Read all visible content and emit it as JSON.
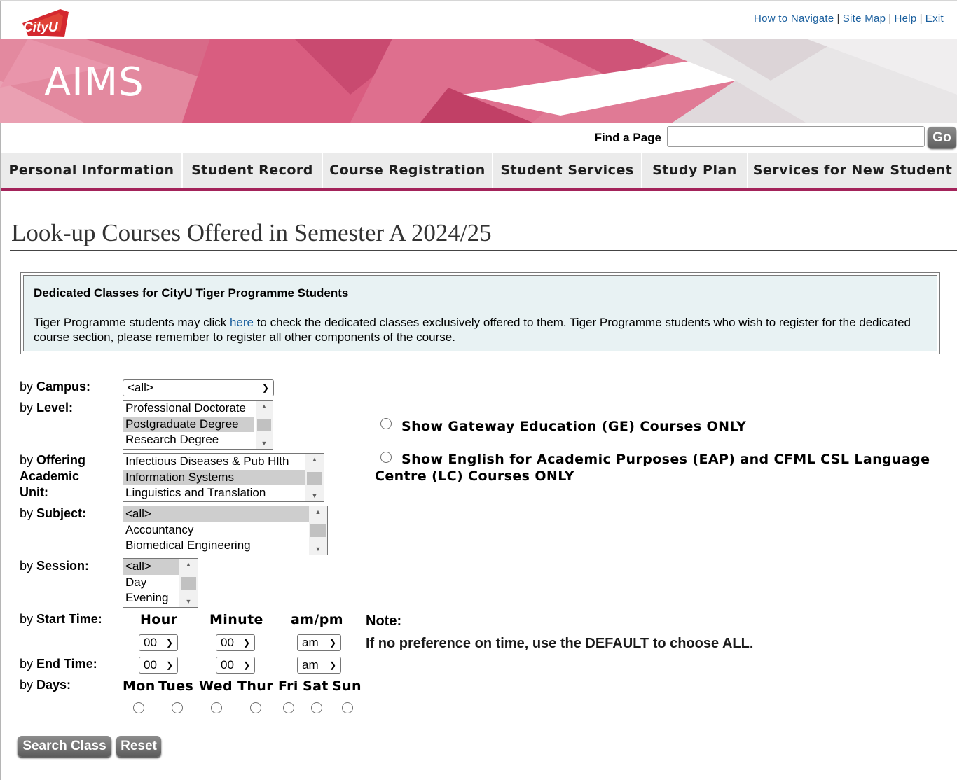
{
  "header": {
    "logo_text": "CityU",
    "links": [
      "How to Navigate",
      "Site Map",
      "Help",
      "Exit"
    ],
    "banner_title": "AIMS"
  },
  "find": {
    "label": "Find a Page",
    "value": "",
    "go_label": "Go"
  },
  "nav": [
    "Personal Information",
    "Student Record",
    "Course Registration",
    "Student Services",
    "Study Plan",
    "Services for New Student"
  ],
  "page_title": "Look-up Courses Offered in Semester A 2024/25",
  "notice": {
    "heading": "Dedicated Classes for CityU Tiger Programme Students",
    "text_1": "Tiger Programme students may click ",
    "link": "here",
    "text_2": " to check the dedicated classes exclusively offered to them. Tiger Programme students who wish to register for the dedicated course section, please remember to register ",
    "underlined": "all other components",
    "text_3": " of the course."
  },
  "filters": {
    "campus": {
      "prefix": "by ",
      "label": "Campus:",
      "value": "<all>"
    },
    "level": {
      "prefix": "by ",
      "label": "Level:",
      "options": [
        "Professional Doctorate",
        "Postgraduate Degree",
        "Research Degree"
      ],
      "selected": 1
    },
    "unit": {
      "prefix": "by ",
      "label_1": "Offering",
      "label_2": "Academic",
      "label_3": "Unit:",
      "options": [
        "Infectious Diseases & Pub Hlth",
        "Information Systems",
        "Linguistics and Translation"
      ],
      "selected": 1
    },
    "subject": {
      "prefix": "by ",
      "label": "Subject:",
      "options": [
        "<all>",
        "Accountancy",
        "Biomedical Engineering"
      ],
      "selected": 0
    },
    "session": {
      "prefix": "by ",
      "label": "Session:",
      "options": [
        "<all>",
        "Day",
        "Evening"
      ],
      "selected": 0
    },
    "start_time": {
      "prefix": "by ",
      "label": "Start Time:",
      "hour": "00",
      "minute": "00",
      "ampm": "am"
    },
    "end_time": {
      "prefix": "by ",
      "label": "End Time:",
      "hour": "00",
      "minute": "00",
      "ampm": "am"
    },
    "time_columns": {
      "hour": "Hour",
      "minute": "Minute",
      "ampm": "am/pm"
    },
    "days": {
      "prefix": "by ",
      "label": "Days:",
      "items": [
        "Mon",
        "Tues",
        "Wed",
        "Thur",
        "Fri",
        "Sat",
        "Sun"
      ]
    }
  },
  "options": {
    "ge_only": "Show Gateway Education (GE) Courses ONLY",
    "eap_only": "Show English for Academic Purposes (EAP) and CFML CSL Language Centre (LC) Courses ONLY"
  },
  "note": {
    "title": "Note:",
    "body": "If no preference on time, use the DEFAULT to choose ALL."
  },
  "buttons": {
    "search": "Search Class",
    "reset": "Reset"
  },
  "colors": {
    "brand": "#a3235a",
    "link": "#1a5f9e",
    "notice_bg": "#e8f2f3"
  }
}
